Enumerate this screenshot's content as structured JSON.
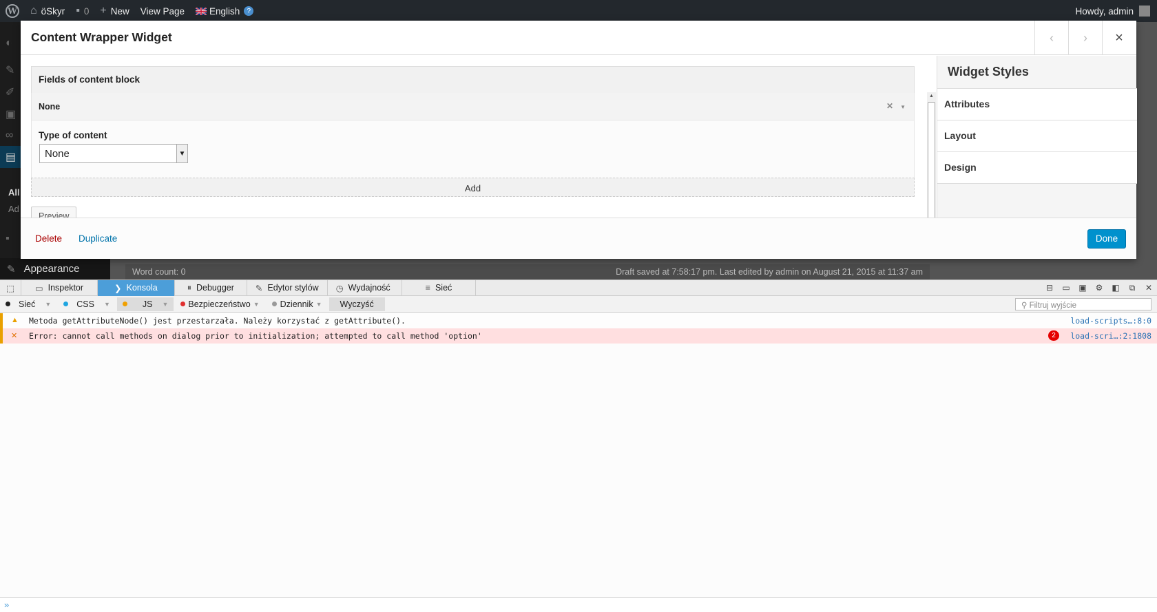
{
  "adminbar": {
    "site_name": "öSkyr",
    "comments_count": "0",
    "new_label": "New",
    "view_page_label": "View Page",
    "language_label": "English",
    "howdy_label": "Howdy, admin"
  },
  "admin_bg": {
    "menu_all": "All",
    "menu_add": "Ad",
    "appearance_label": "Appearance",
    "word_count": "Word count: 0",
    "draft_status": "Draft saved at 7:58:17 pm. Last edited by admin on August 21, 2015 at 11:37 am"
  },
  "modal": {
    "title": "Content Wrapper Widget",
    "section_title": "Fields of content block",
    "field_row_label": "None",
    "type_label": "Type of content",
    "type_value": "None",
    "add_label": "Add",
    "preview_label": "Preview",
    "styles_title": "Widget Styles",
    "style_sections": [
      "Attributes",
      "Layout",
      "Design"
    ],
    "delete_label": "Delete",
    "duplicate_label": "Duplicate",
    "done_label": "Done"
  },
  "devtools": {
    "tabs": [
      "Inspektor",
      "Konsola",
      "Debugger",
      "Edytor stylów",
      "Wydajność",
      "Sieć"
    ],
    "active_tab": "Konsola",
    "filters": [
      "Sieć",
      "CSS",
      "JS",
      "Bezpieczeństwo",
      "Dziennik",
      "Wyczyść"
    ],
    "filter_placeholder": "Filtruj wyjście",
    "messages": [
      {
        "level": "warning",
        "text": "Metoda getAttributeNode() jest przestarzała. Należy korzystać z getAttribute().",
        "source": "load-scripts…:8:0"
      },
      {
        "level": "error",
        "text": "Error: cannot call methods on dialog prior to initialization; attempted to call method 'option'",
        "source": "load-scri…:2:1808",
        "count": "2"
      }
    ],
    "prompt": "»"
  },
  "colors": {
    "adminbar_bg": "#23282d",
    "accent_blue": "#0091cd",
    "devtools_active": "#4c9ed9",
    "error_bg": "#ffdfe0",
    "delete_red": "#aa0000"
  }
}
